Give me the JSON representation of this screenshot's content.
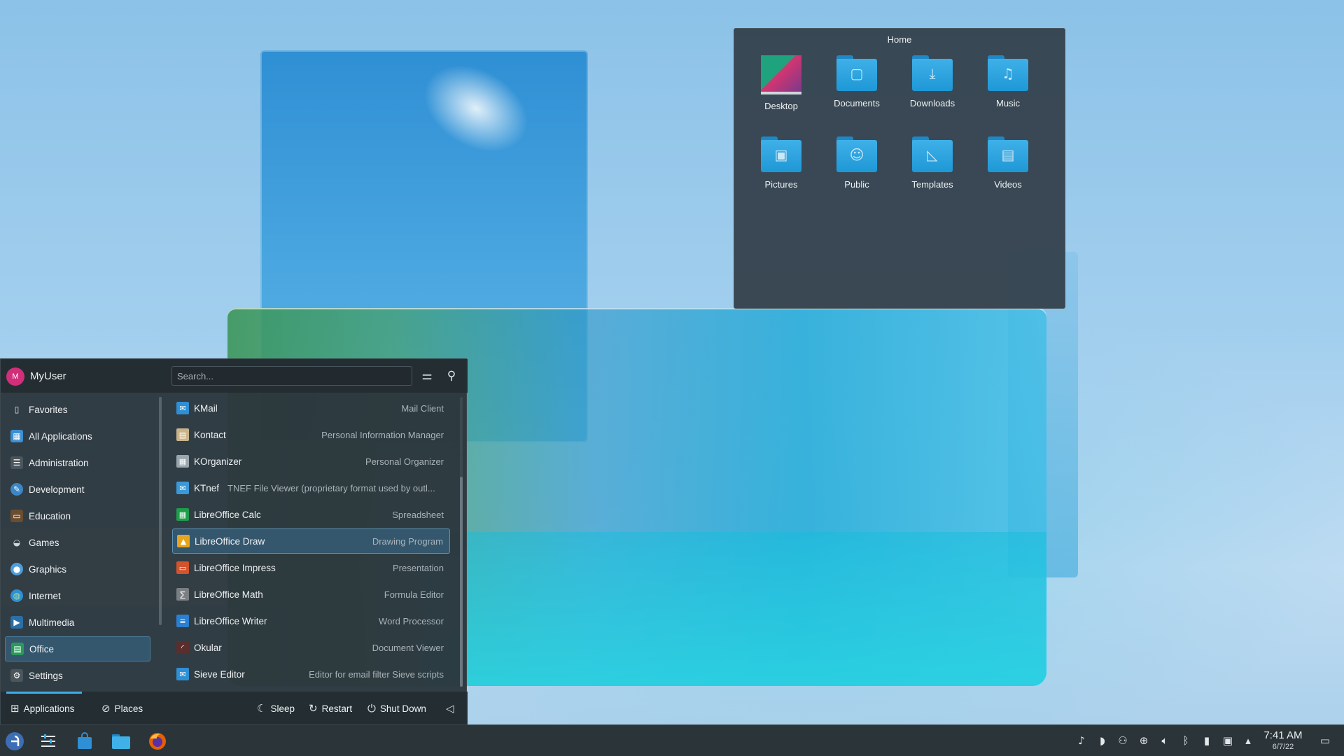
{
  "folder_view": {
    "title": "Home",
    "items": [
      {
        "label": "Desktop",
        "icon": "desktop-folder-icon",
        "glyph": ""
      },
      {
        "label": "Documents",
        "icon": "documents-folder-icon",
        "glyph": "▢"
      },
      {
        "label": "Downloads",
        "icon": "downloads-folder-icon",
        "glyph": "⤓"
      },
      {
        "label": "Music",
        "icon": "music-folder-icon",
        "glyph": "♫"
      },
      {
        "label": "Pictures",
        "icon": "pictures-folder-icon",
        "glyph": "▣"
      },
      {
        "label": "Public",
        "icon": "public-folder-icon",
        "glyph": "☺"
      },
      {
        "label": "Templates",
        "icon": "templates-folder-icon",
        "glyph": "◺"
      },
      {
        "label": "Videos",
        "icon": "videos-folder-icon",
        "glyph": "▤"
      }
    ]
  },
  "launcher": {
    "user": {
      "name": "MyUser",
      "avatar_letter": "M"
    },
    "search": {
      "placeholder": "Search..."
    },
    "header_buttons": {
      "configure_icon": "settings-sliders-icon",
      "pin_icon": "pin-icon"
    },
    "categories": [
      {
        "label": "Favorites",
        "icon": "bookmark-icon",
        "active": false
      },
      {
        "label": "All Applications",
        "icon": "grid-icon",
        "active": false
      },
      {
        "label": "Administration",
        "icon": "admin-icon",
        "active": false
      },
      {
        "label": "Development",
        "icon": "development-icon",
        "active": false
      },
      {
        "label": "Education",
        "icon": "education-icon",
        "active": false
      },
      {
        "label": "Games",
        "icon": "gamepad-icon",
        "active": false
      },
      {
        "label": "Graphics",
        "icon": "graphics-icon",
        "active": false
      },
      {
        "label": "Internet",
        "icon": "globe-icon",
        "active": false
      },
      {
        "label": "Multimedia",
        "icon": "multimedia-icon",
        "active": false
      },
      {
        "label": "Office",
        "icon": "office-icon",
        "active": true
      },
      {
        "label": "Settings",
        "icon": "settings-icon",
        "active": false
      }
    ],
    "apps": [
      {
        "name": "KMail",
        "description": "Mail Client",
        "icon": "kmail-icon",
        "color": "#2f8fd4",
        "active": false,
        "inline_desc": false
      },
      {
        "name": "Kontact",
        "description": "Personal Information Manager",
        "icon": "kontact-icon",
        "color": "#c9b48a",
        "active": false,
        "inline_desc": false
      },
      {
        "name": "KOrganizer",
        "description": "Personal Organizer",
        "icon": "korganizer-icon",
        "color": "#9aa6ad",
        "active": false,
        "inline_desc": false
      },
      {
        "name": "KTnef",
        "description": "TNEF File Viewer (proprietary format used by outl...",
        "icon": "ktnef-icon",
        "color": "#3a9ad9",
        "active": false,
        "inline_desc": true
      },
      {
        "name": "LibreOffice Calc",
        "description": "Spreadsheet",
        "icon": "libreoffice-calc-icon",
        "color": "#1e9e4a",
        "active": false,
        "inline_desc": false
      },
      {
        "name": "LibreOffice Draw",
        "description": "Drawing Program",
        "icon": "libreoffice-draw-icon",
        "color": "#e5a51f",
        "active": true,
        "inline_desc": false
      },
      {
        "name": "LibreOffice Impress",
        "description": "Presentation",
        "icon": "libreoffice-impress-icon",
        "color": "#d2532d",
        "active": false,
        "inline_desc": false
      },
      {
        "name": "LibreOffice Math",
        "description": "Formula Editor",
        "icon": "libreoffice-math-icon",
        "color": "#7a7f84",
        "active": false,
        "inline_desc": false
      },
      {
        "name": "LibreOffice Writer",
        "description": "Word Processor",
        "icon": "libreoffice-writer-icon",
        "color": "#2b7fd0",
        "active": false,
        "inline_desc": false
      },
      {
        "name": "Okular",
        "description": "Document Viewer",
        "icon": "okular-icon",
        "color": "#5b2d2d",
        "active": false,
        "inline_desc": false
      },
      {
        "name": "Sieve Editor",
        "description": "Editor for email filter Sieve scripts",
        "icon": "sieve-editor-icon",
        "color": "#2f8fd4",
        "active": false,
        "inline_desc": false
      }
    ],
    "footer": {
      "applications_label": "Applications",
      "places_label": "Places",
      "sleep_label": "Sleep",
      "restart_label": "Restart",
      "shutdown_label": "Shut Down"
    }
  },
  "panel": {
    "clock_time": "7:41 AM",
    "clock_date": "6/7/22",
    "accent_color": "#3daee9"
  }
}
